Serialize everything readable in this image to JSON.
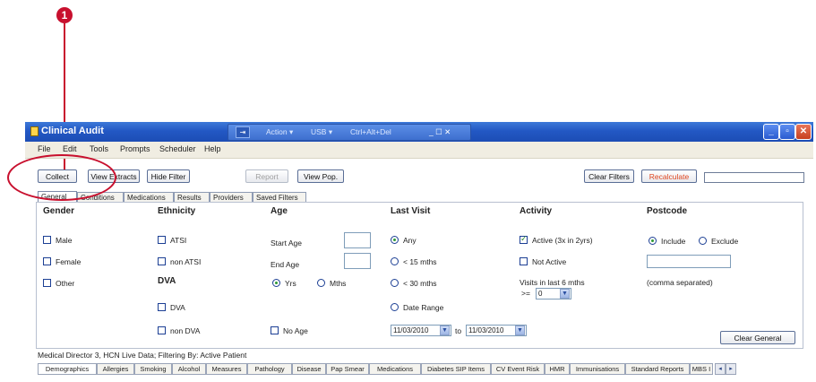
{
  "callout": {
    "number": "1"
  },
  "window": {
    "title": "Clinical Audit",
    "remote_bar": {
      "pin": "⇥",
      "action": "Action ▾",
      "usb": "USB ▾",
      "ctrl_alt_del": "Ctrl+Alt+Del",
      "controls": "_ ☐ ✕"
    },
    "controls": {
      "minimize": "_",
      "maximize": "▫",
      "close": "✕"
    }
  },
  "menu": {
    "file": "File",
    "edit": "Edit",
    "tools": "Tools",
    "prompts": "Prompts",
    "scheduler": "Scheduler",
    "help": "Help"
  },
  "toolbar": {
    "collect": "Collect",
    "view_extracts": "View Extracts",
    "hide_filter": "Hide Filter",
    "report": "Report",
    "view_pop": "View Pop.",
    "clear_filters": "Clear Filters",
    "recalculate": "Recalculate"
  },
  "filter_tabs": [
    "General",
    "Conditions",
    "Medications",
    "Results",
    "Providers",
    "Saved Filters"
  ],
  "general": {
    "gender": {
      "header": "Gender",
      "male": "Male",
      "female": "Female",
      "other": "Other"
    },
    "ethnicity": {
      "header": "Ethnicity",
      "atsi": "ATSI",
      "non_atsi": "non ATSI"
    },
    "dva": {
      "header": "DVA",
      "dva": "DVA",
      "non_dva": "non DVA"
    },
    "age": {
      "header": "Age",
      "start_age": "Start Age",
      "end_age": "End Age",
      "yrs": "Yrs",
      "mths": "Mths",
      "no_age": "No Age"
    },
    "last_visit": {
      "header": "Last Visit",
      "any": "Any",
      "lt15": "< 15 mths",
      "lt30": "< 30 mths",
      "date_range": "Date Range",
      "from_date": "11/03/2010",
      "to": "to",
      "to_date": "11/03/2010"
    },
    "activity": {
      "header": "Activity",
      "active": "Active (3x in 2yrs)",
      "not_active": "Not Active",
      "visits_label": "Visits in last 6 mths",
      "gte": ">=",
      "visits_value": "0"
    },
    "postcode": {
      "header": "Postcode",
      "include": "Include",
      "exclude": "Exclude",
      "note": "(comma separated)"
    },
    "clear_general": "Clear General"
  },
  "status_text": "Medical Director 3, HCN Live Data; Filtering By: Active Patient",
  "bottom_tabs": [
    "Demographics",
    "Allergies",
    "Smoking",
    "Alcohol",
    "Measures",
    "Pathology",
    "Disease",
    "Pap Smear",
    "Medications",
    "Diabetes SIP Items",
    "CV Event Risk",
    "HMR",
    "Immunisations",
    "Standard Reports",
    "MBS I"
  ],
  "scroll": {
    "left": "◂",
    "right": "▸"
  },
  "colors": {
    "callout": "#c8102e",
    "titlebar": "#2358c4",
    "recalculate": "#e0461f"
  }
}
